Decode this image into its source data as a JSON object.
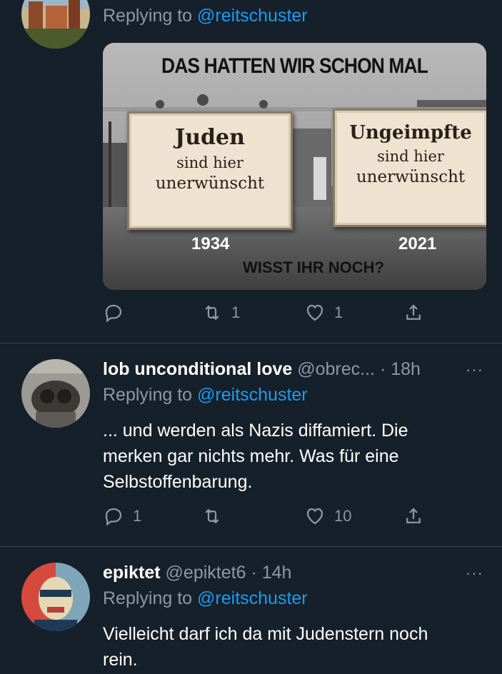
{
  "colors": {
    "background": "#15202b",
    "muted": "#8b98a5",
    "link": "#1d9bf0",
    "divider": "#38444d"
  },
  "tweet1": {
    "replying_prefix": "Replying to",
    "replying_handle": "@reitschuster",
    "image": {
      "headline": "DAS HATTEN WIR SCHON MAL",
      "sign_left": {
        "line1": "Juden",
        "line2": "sind hier",
        "line3": "unerwünscht"
      },
      "sign_right": {
        "line1": "Ungeimpfte",
        "line2": "sind hier",
        "line3": "unerwünscht"
      },
      "year_left": "1934",
      "year_right": "2021",
      "caption": "WISST IHR NOCH?"
    },
    "actions": {
      "reply_icon": "reply-icon",
      "retweet_icon": "retweet-icon",
      "retweet_count": "1",
      "like_icon": "heart-icon",
      "like_count": "1",
      "share_icon": "share-icon"
    }
  },
  "tweet2": {
    "display_name": "lob unconditional love",
    "handle": "@obrec...",
    "time": "· 18h",
    "more": "···",
    "replying_prefix": "Replying to",
    "replying_handle": "@reitschuster",
    "text_lines": [
      "... und werden als Nazis diffamiert. Die",
      "merken gar nichts mehr. Was für eine",
      "Selbstoffenbarung."
    ],
    "actions": {
      "reply_count": "1",
      "retweet_count": "",
      "like_count": "10"
    }
  },
  "tweet3": {
    "display_name": "epiktet",
    "handle": "@epiktet6",
    "time": "· 14h",
    "more": "···",
    "replying_prefix": "Replying to",
    "replying_handle": "@reitschuster",
    "text_lines": [
      "Vielleicht darf ich da mit Judenstern noch",
      "rein."
    ]
  }
}
